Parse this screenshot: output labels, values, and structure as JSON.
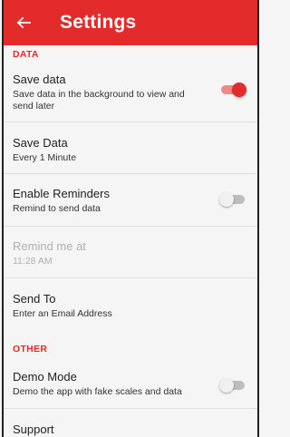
{
  "appbar": {
    "title": "Settings",
    "back_icon": "arrow-left-icon"
  },
  "sections": {
    "data_header": "DATA",
    "other_header": "OTHER"
  },
  "settings": {
    "save_data_toggle": {
      "label": "Save data",
      "summary": "Save data in the background to view and send later",
      "enabled": true
    },
    "save_interval": {
      "label": "Save Data",
      "summary": "Every 1 Minute"
    },
    "enable_reminders": {
      "label": "Enable Reminders",
      "summary": "Remind to send data",
      "enabled": false
    },
    "remind_me_at": {
      "label": "Remind me at",
      "summary": "11:28 AM",
      "disabled": true
    },
    "send_to": {
      "label": "Send To",
      "summary": "Enter an Email Address"
    },
    "demo_mode": {
      "label": "Demo Mode",
      "summary": "Demo the app with fake scales and data",
      "enabled": false
    },
    "support": {
      "label": "Support"
    }
  },
  "colors": {
    "accent": "#e42b2b",
    "background": "#f5f5f5",
    "disabled_text": "#b0b0b0"
  }
}
